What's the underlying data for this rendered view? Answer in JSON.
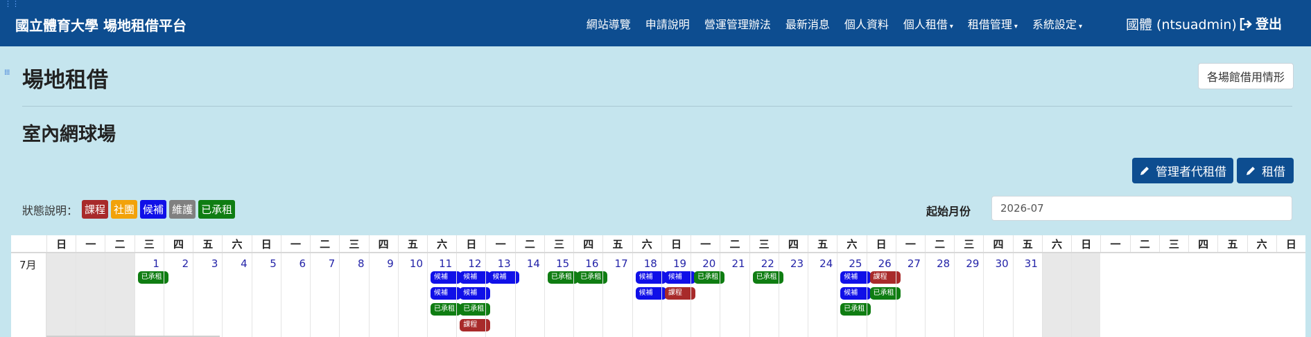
{
  "navbar": {
    "brand": "國立體育大學 場地租借平台",
    "items": [
      {
        "label": "網站導覽",
        "dropdown": false
      },
      {
        "label": "申請說明",
        "dropdown": false
      },
      {
        "label": "營運管理辦法",
        "dropdown": false
      },
      {
        "label": "最新消息",
        "dropdown": false
      },
      {
        "label": "個人資料",
        "dropdown": false
      },
      {
        "label": "個人租借",
        "dropdown": true
      },
      {
        "label": "租借管理",
        "dropdown": true
      },
      {
        "label": "系統設定",
        "dropdown": true
      }
    ],
    "user": "國體 (ntsuadmin)",
    "logout": "登出"
  },
  "page": {
    "title": "場地租借",
    "venue_status_button": "各場館借用情形",
    "venue_title": "室內網球場",
    "admin_rent_button": "管理者代租借",
    "rent_button": "租借"
  },
  "legend": {
    "label": "狀態說明：",
    "items": [
      {
        "label": "課程",
        "color": "#a82a2a"
      },
      {
        "label": "社團",
        "color": "#f2a20a"
      },
      {
        "label": "候補",
        "color": "#1010e8"
      },
      {
        "label": "維護",
        "color": "#808080"
      },
      {
        "label": "已承租",
        "color": "#0f7d12"
      }
    ]
  },
  "start_month": {
    "label": "起始月份",
    "value": "2026-07"
  },
  "calendar": {
    "weekday_headers": [
      "日",
      "一",
      "二",
      "三",
      "四",
      "五",
      "六",
      "日",
      "一",
      "二",
      "三",
      "四",
      "五",
      "六",
      "日",
      "一",
      "二",
      "三",
      "四",
      "五",
      "六",
      "日",
      "一",
      "二",
      "三",
      "四",
      "五",
      "六",
      "日",
      "一",
      "二",
      "三",
      "四",
      "五",
      "六",
      "日",
      "一",
      "二",
      "三",
      "四",
      "五",
      "六",
      "日"
    ],
    "month_label": "7月",
    "leading_empty": 3,
    "trailing_empty": 2,
    "days": [
      {
        "day": "1",
        "events": [
          "已承租"
        ]
      },
      {
        "day": "2",
        "events": []
      },
      {
        "day": "3",
        "events": []
      },
      {
        "day": "4",
        "events": []
      },
      {
        "day": "5",
        "events": []
      },
      {
        "day": "6",
        "events": []
      },
      {
        "day": "7",
        "events": []
      },
      {
        "day": "8",
        "events": []
      },
      {
        "day": "9",
        "events": []
      },
      {
        "day": "10",
        "events": []
      },
      {
        "day": "11",
        "events": [
          "候補",
          "候補",
          "已承租"
        ]
      },
      {
        "day": "12",
        "events": [
          "候補",
          "候補",
          "已承租",
          "課程"
        ]
      },
      {
        "day": "13",
        "events": [
          "候補"
        ]
      },
      {
        "day": "14",
        "events": []
      },
      {
        "day": "15",
        "events": [
          "已承租"
        ]
      },
      {
        "day": "16",
        "events": [
          "已承租"
        ]
      },
      {
        "day": "17",
        "events": []
      },
      {
        "day": "18",
        "events": [
          "候補",
          "候補"
        ]
      },
      {
        "day": "19",
        "events": [
          "候補",
          "課程"
        ]
      },
      {
        "day": "20",
        "events": [
          "已承租"
        ]
      },
      {
        "day": "21",
        "events": []
      },
      {
        "day": "22",
        "events": [
          "已承租"
        ]
      },
      {
        "day": "23",
        "events": []
      },
      {
        "day": "24",
        "events": []
      },
      {
        "day": "25",
        "events": [
          "候補",
          "候補",
          "已承租"
        ]
      },
      {
        "day": "26",
        "events": [
          "課程",
          "已承租"
        ]
      },
      {
        "day": "27",
        "events": []
      },
      {
        "day": "28",
        "events": []
      },
      {
        "day": "29",
        "events": []
      },
      {
        "day": "30",
        "events": []
      },
      {
        "day": "31",
        "events": []
      }
    ]
  }
}
